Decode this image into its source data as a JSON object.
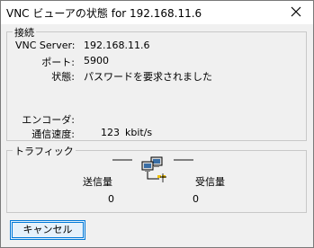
{
  "window": {
    "title": "VNC ビューアの状態 for 192.168.11.6",
    "close_icon": "close-icon"
  },
  "connection": {
    "group_label": "接続",
    "server_label": "VNC Server:",
    "server_value": "192.168.11.6",
    "port_label": "ポート:",
    "port_value": "5900",
    "status_label": "状態:",
    "status_value": "パスワードを要求されました",
    "encoder_label": "エンコーダ:",
    "encoder_value": "",
    "speed_label": "通信速度:",
    "speed_value": "123",
    "speed_unit": "kbit/s"
  },
  "traffic": {
    "group_label": "トラフィック",
    "sent_label": "送信量",
    "sent_value": "0",
    "received_label": "受信量",
    "received_value": "0",
    "icon": "network-computers-icon"
  },
  "buttons": {
    "cancel_label": "キャンセル"
  }
}
